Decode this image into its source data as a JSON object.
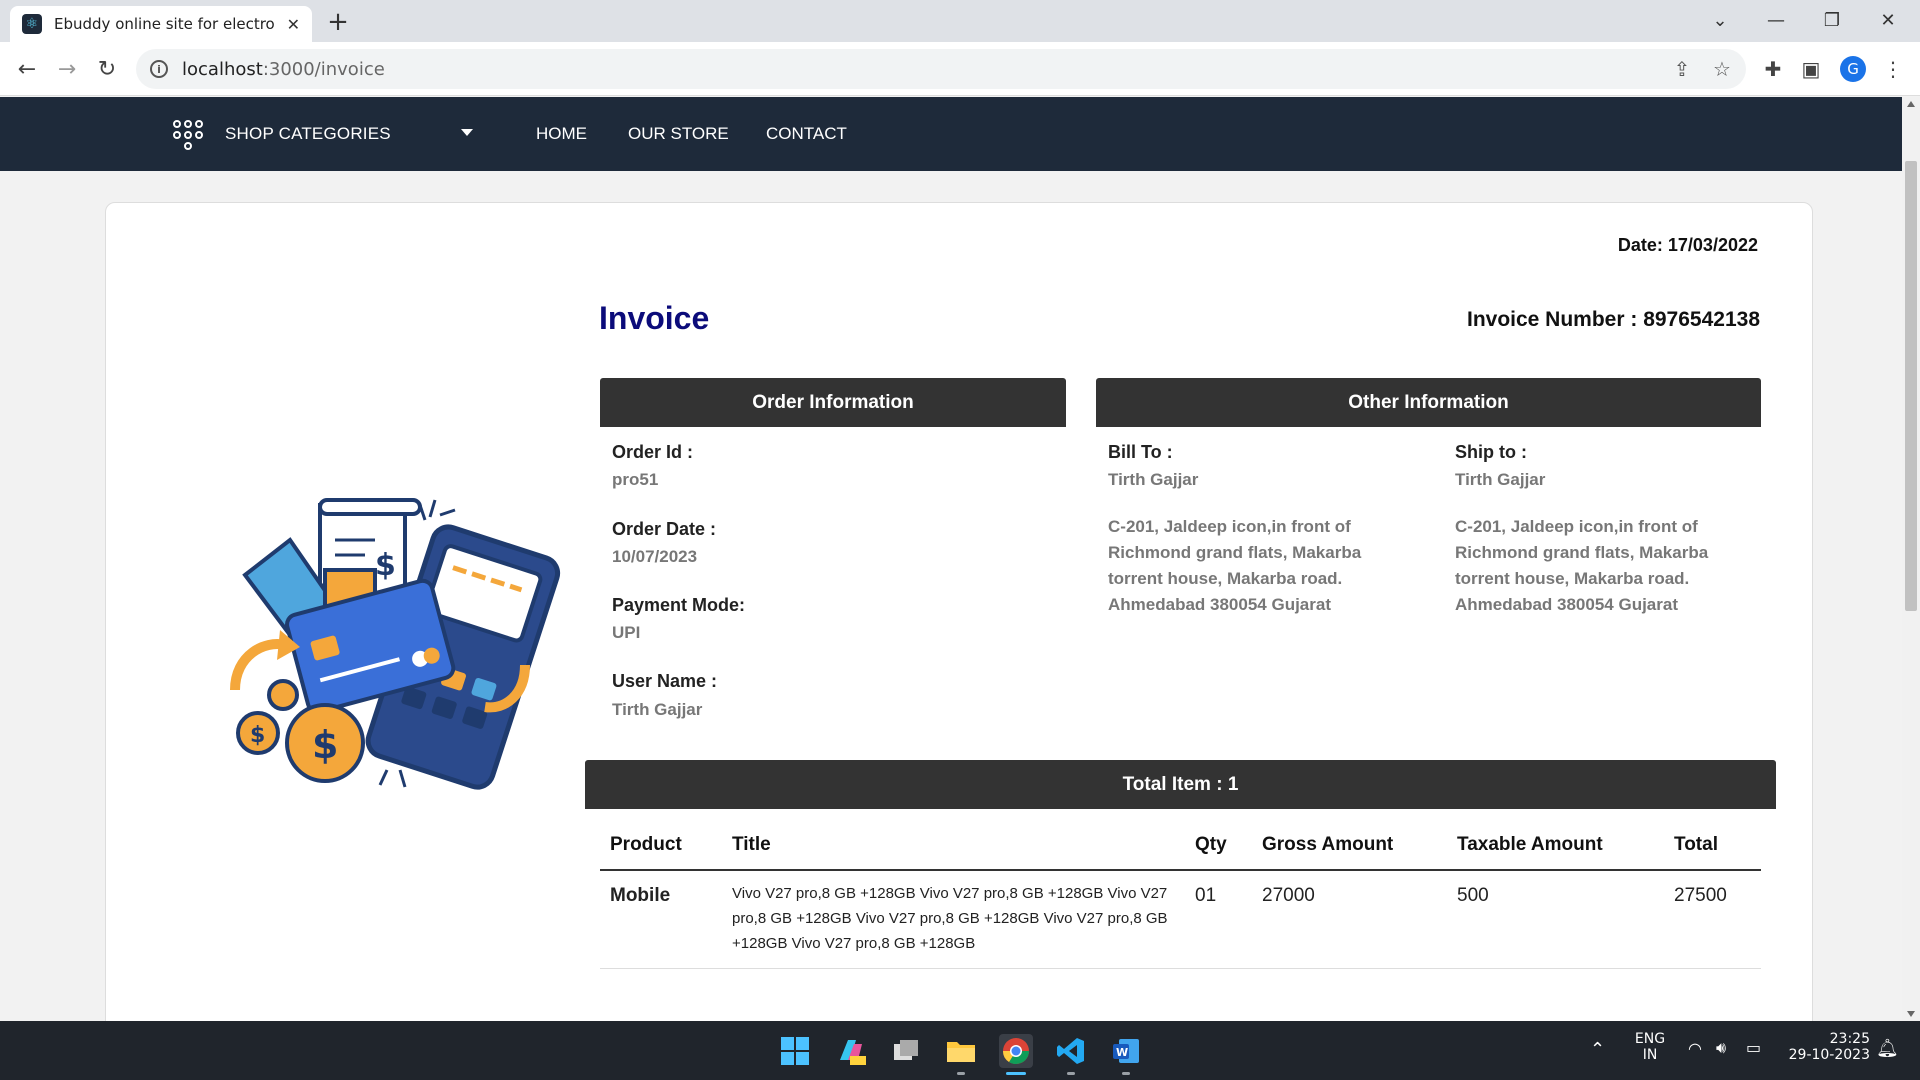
{
  "browser": {
    "tab_title": "Ebuddy online site for electronic",
    "url_host": "localhost",
    "url_path": ":3000/invoice"
  },
  "icons": {
    "back": "back-arrow-icon",
    "forward": "forward-arrow-icon",
    "reload": "reload-icon",
    "info": "info-icon",
    "share": "share-icon",
    "bookmark": "star-icon",
    "extensions": "puzzle-icon",
    "sidepanel": "side-panel-icon",
    "menu": "kebab-menu-icon"
  },
  "profile": {
    "initial": "G"
  },
  "nav": {
    "categories_label": "SHOP CATEGORIES",
    "links": [
      "HOME",
      "OUR STORE",
      "CONTACT"
    ]
  },
  "invoice": {
    "date": "Date: 17/03/2022",
    "title": "Invoice",
    "number_label": "Invoice Number :",
    "number": "8976542138",
    "order_info_heading": "Order Information",
    "other_info_heading": "Other Information",
    "order": {
      "order_id_label": "Order Id :",
      "order_id": "pro51",
      "order_date_label": "Order Date :",
      "order_date": "10/07/2023",
      "payment_label": "Payment Mode:",
      "payment": "UPI",
      "user_label": "User Name :",
      "user": "Tirth Gajjar"
    },
    "bill_to": {
      "label": "Bill To :",
      "name": "Tirth Gajjar",
      "address": "C-201, Jaldeep icon,in front of Richmond grand flats, Makarba torrent house, Makarba road. Ahmedabad 380054 Gujarat"
    },
    "ship_to": {
      "label": "Ship to :",
      "name": "Tirth Gajjar",
      "address": "C-201, Jaldeep icon,in front of Richmond grand flats, Makarba torrent house, Makarba road. Ahmedabad 380054 Gujarat"
    },
    "total_items": "Total Item : 1",
    "columns": [
      "Product",
      "Title",
      "Qty",
      "Gross Amount",
      "Taxable Amount",
      "Total"
    ],
    "rows": [
      {
        "product": "Mobile",
        "title": "Vivo V27 pro,8 GB +128GB Vivo V27 pro,8 GB +128GB Vivo V27 pro,8 GB +128GB Vivo V27 pro,8 GB +128GB Vivo V27 pro,8 GB +128GB Vivo V27 pro,8 GB +128GB",
        "qty": "01",
        "gross": "27000",
        "taxable": "500",
        "total": "27500"
      }
    ]
  },
  "taskbar": {
    "lang_top": "ENG",
    "lang_bottom": "IN",
    "time": "23:25",
    "date": "29-10-2023"
  }
}
